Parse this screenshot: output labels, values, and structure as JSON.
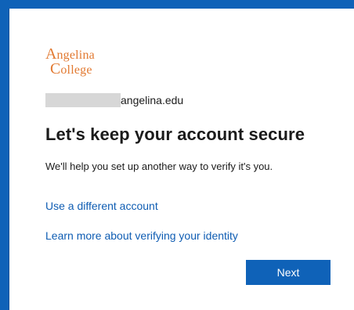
{
  "logo": {
    "line1_cap": "A",
    "line1_rest": "ngelina",
    "line2_cap": "C",
    "line2_rest": "ollege"
  },
  "account": {
    "email_domain": "angelina.edu"
  },
  "heading": {
    "title": "Let's keep your account secure",
    "description": "We'll help you set up another way to verify it's you."
  },
  "links": {
    "different_account": "Use a different account",
    "learn_more": "Learn more about verifying your identity"
  },
  "actions": {
    "next_label": "Next"
  },
  "colors": {
    "accent": "#0f62b8",
    "link": "#0f5db3",
    "logo": "#e27a32"
  }
}
